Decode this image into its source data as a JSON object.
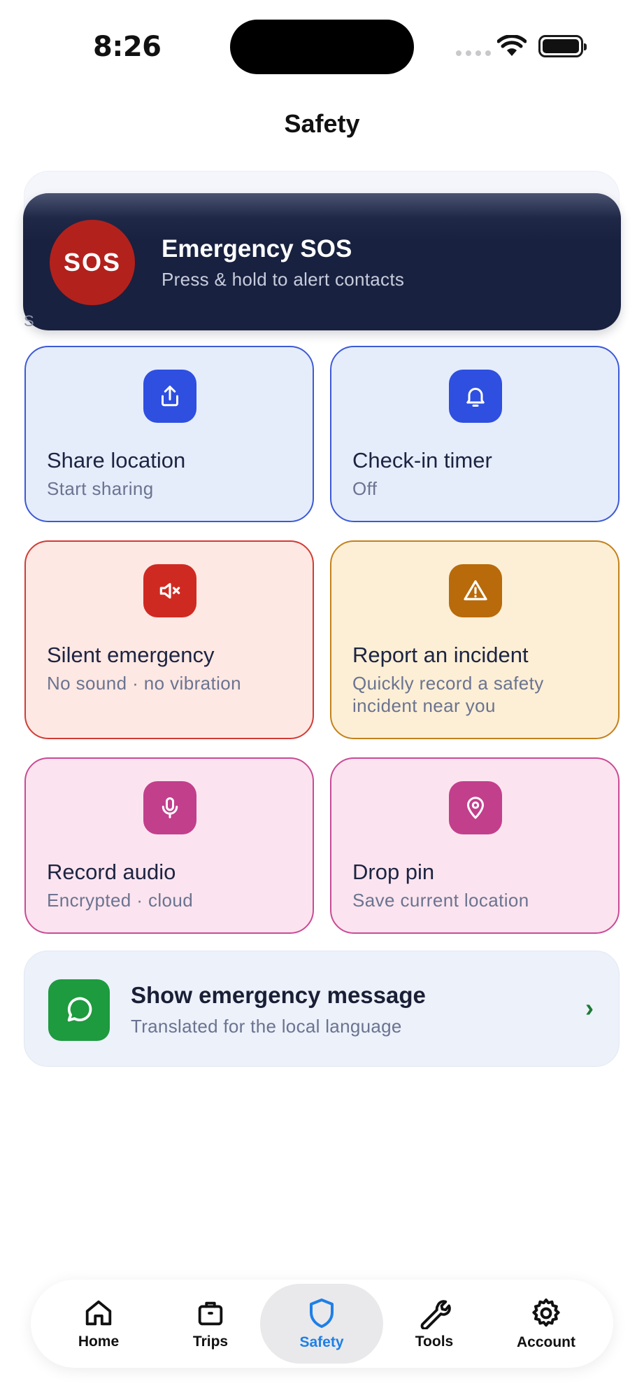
{
  "status_bar": {
    "time": "8:26"
  },
  "header": {
    "title": "Safety"
  },
  "sos": {
    "badge": "SOS",
    "title": "Emergency SOS",
    "subtitle": "Press & hold to alert contacts",
    "color": "#b3211d"
  },
  "section_fragment": "S",
  "tiles": [
    {
      "title": "Share location",
      "subtitle": "Start sharing",
      "icon": "share-icon",
      "color": "#2e4fe0"
    },
    {
      "title": "Check-in timer",
      "subtitle": "Off",
      "icon": "bell-icon",
      "color": "#2e4fe0"
    },
    {
      "title": "Silent emergency",
      "subtitle": "No sound · no vibration",
      "icon": "mute-icon",
      "color": "#cf2a22"
    },
    {
      "title": "Report an incident",
      "subtitle": "Quickly record a safety incident near you",
      "icon": "warning-icon",
      "color": "#b96a0a"
    },
    {
      "title": "Record audio",
      "subtitle": "Encrypted · cloud",
      "icon": "microphone-icon",
      "color": "#c23f8c"
    },
    {
      "title": "Drop pin",
      "subtitle": "Save current location",
      "icon": "map-pin-icon",
      "color": "#c23f8c"
    }
  ],
  "emergency_message": {
    "title": "Show emergency message",
    "subtitle": "Translated for the local language",
    "icon": "chat-bubble-icon",
    "color": "#1e9a3f"
  },
  "nav": {
    "items": [
      {
        "label": "Home",
        "icon": "home-icon"
      },
      {
        "label": "Trips",
        "icon": "suitcase-icon"
      },
      {
        "label": "Safety",
        "icon": "shield-icon",
        "active": true
      },
      {
        "label": "Tools",
        "icon": "wrench-icon"
      },
      {
        "label": "Account",
        "icon": "gear-icon"
      }
    ],
    "active_color": "#1f7fe6"
  }
}
